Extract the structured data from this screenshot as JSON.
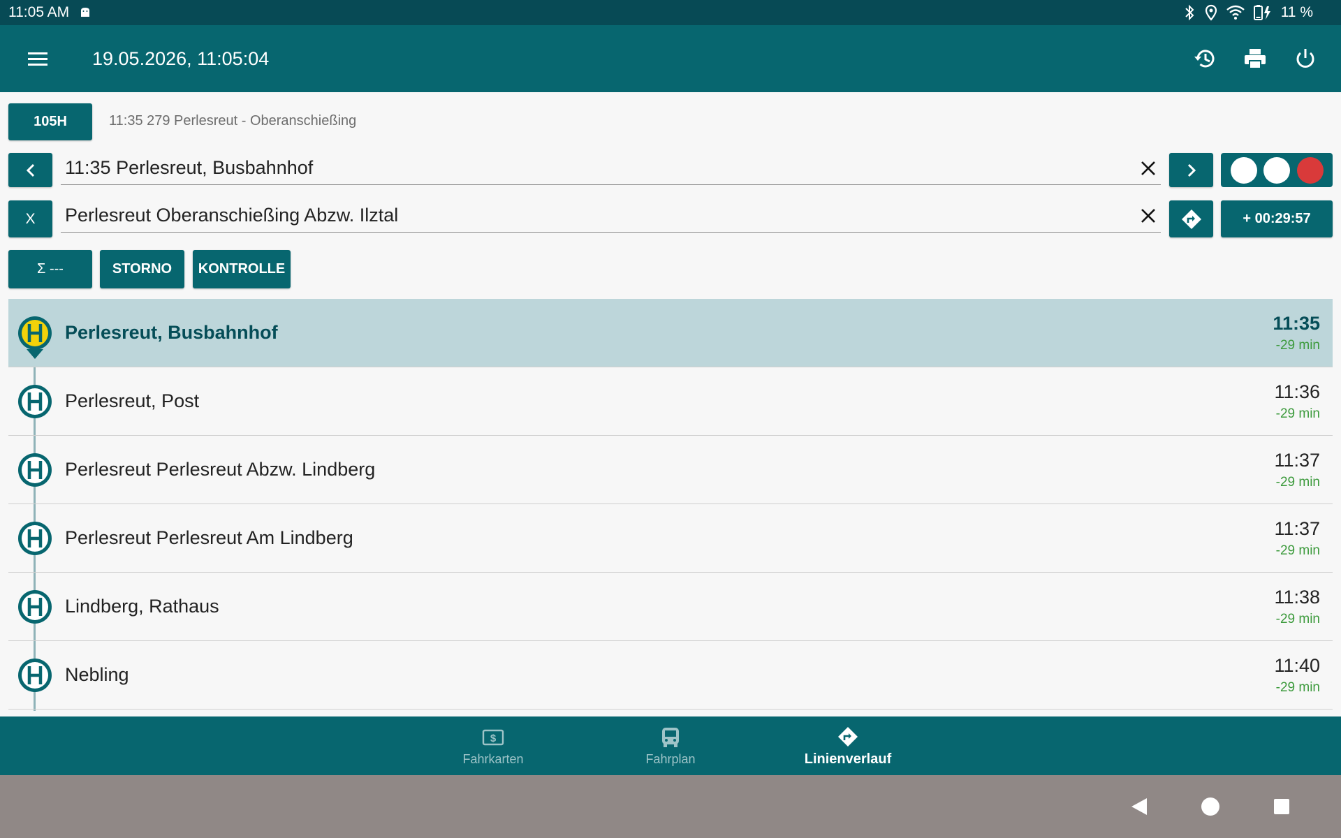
{
  "statusbar": {
    "time": "11:05 AM",
    "battery": "11 %"
  },
  "appbar": {
    "title": "19.05.2026, 11:05:04"
  },
  "trip": {
    "line_code": "105H",
    "info": "11:35 279 Perlesreut - Oberanschießing",
    "from": "11:35 Perlesreut, Busbahnhof",
    "to": "Perlesreut Oberanschießing Abzw. Ilztal",
    "clear_button": "X",
    "countdown": "+ 00:29:57"
  },
  "actions": {
    "sum_label": "Σ ---",
    "storno_label": "STORNO",
    "kontrolle_label": "KONTROLLE"
  },
  "lights": {
    "colors": [
      "#ffffff",
      "#ffffff",
      "#d93a3a"
    ]
  },
  "stops": [
    {
      "name": "Perlesreut, Busbahnhof",
      "time": "11:35",
      "delay": "-29 min"
    },
    {
      "name": "Perlesreut, Post",
      "time": "11:36",
      "delay": "-29 min"
    },
    {
      "name": "Perlesreut Perlesreut Abzw. Lindberg",
      "time": "11:37",
      "delay": "-29 min"
    },
    {
      "name": "Perlesreut Perlesreut Am Lindberg",
      "time": "11:37",
      "delay": "-29 min"
    },
    {
      "name": "Lindberg, Rathaus",
      "time": "11:38",
      "delay": "-29 min"
    },
    {
      "name": "Nebling",
      "time": "11:40",
      "delay": "-29 min"
    }
  ],
  "nav": {
    "tickets": "Fahrkarten",
    "schedule": "Fahrplan",
    "route": "Linienverlauf"
  },
  "colors": {
    "primary": "#07666f",
    "statusbar": "#074a55",
    "highlight": "#bdd6da",
    "delay": "#3c9a3c",
    "stop_active": "#f2d20a"
  }
}
